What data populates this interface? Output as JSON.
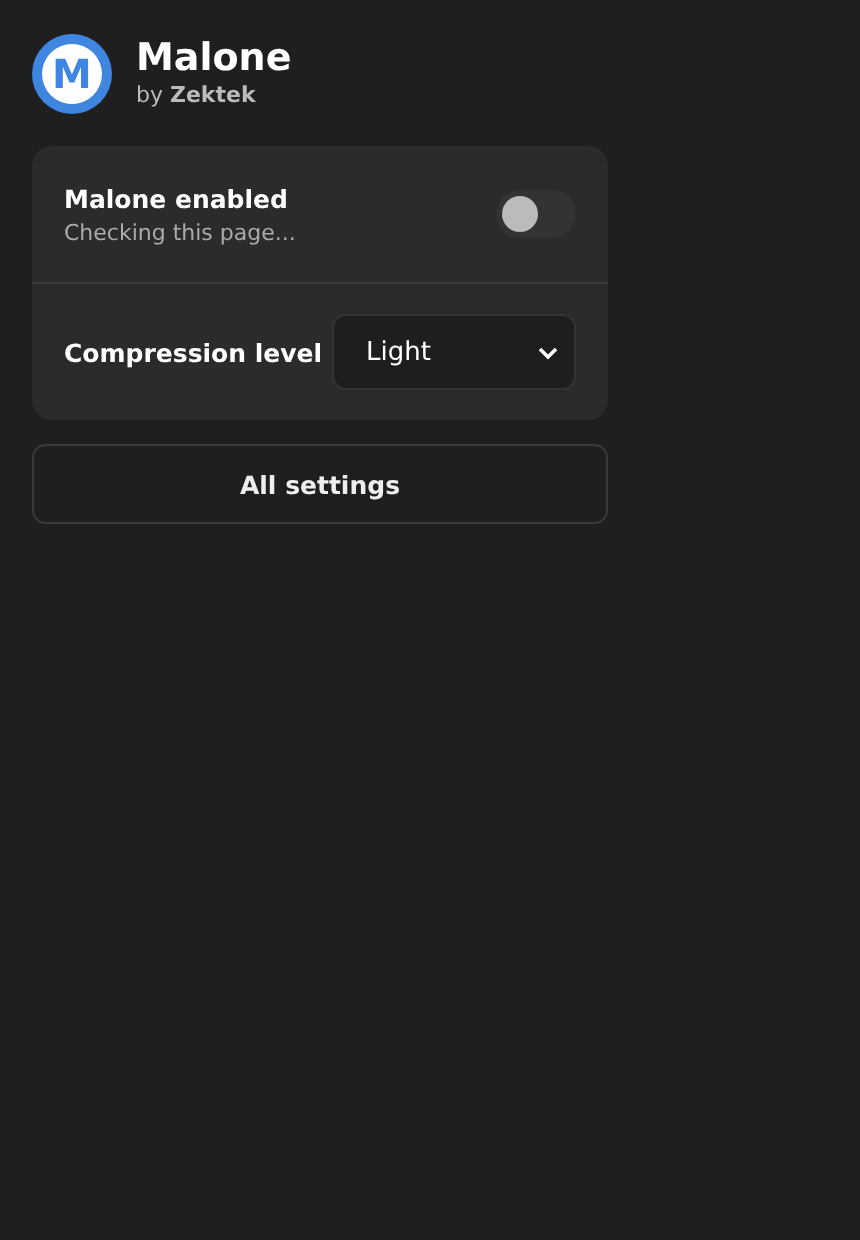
{
  "header": {
    "logo_letter": "M",
    "title": "Malone",
    "byline": "by **Zektek**"
  },
  "settings": {
    "toggle_row": {
      "label": "Malone enabled",
      "status": "Checking this page...",
      "on": false
    },
    "select_row": {
      "label": "Compression level",
      "value": "Light"
    }
  },
  "button": "All settings"
}
